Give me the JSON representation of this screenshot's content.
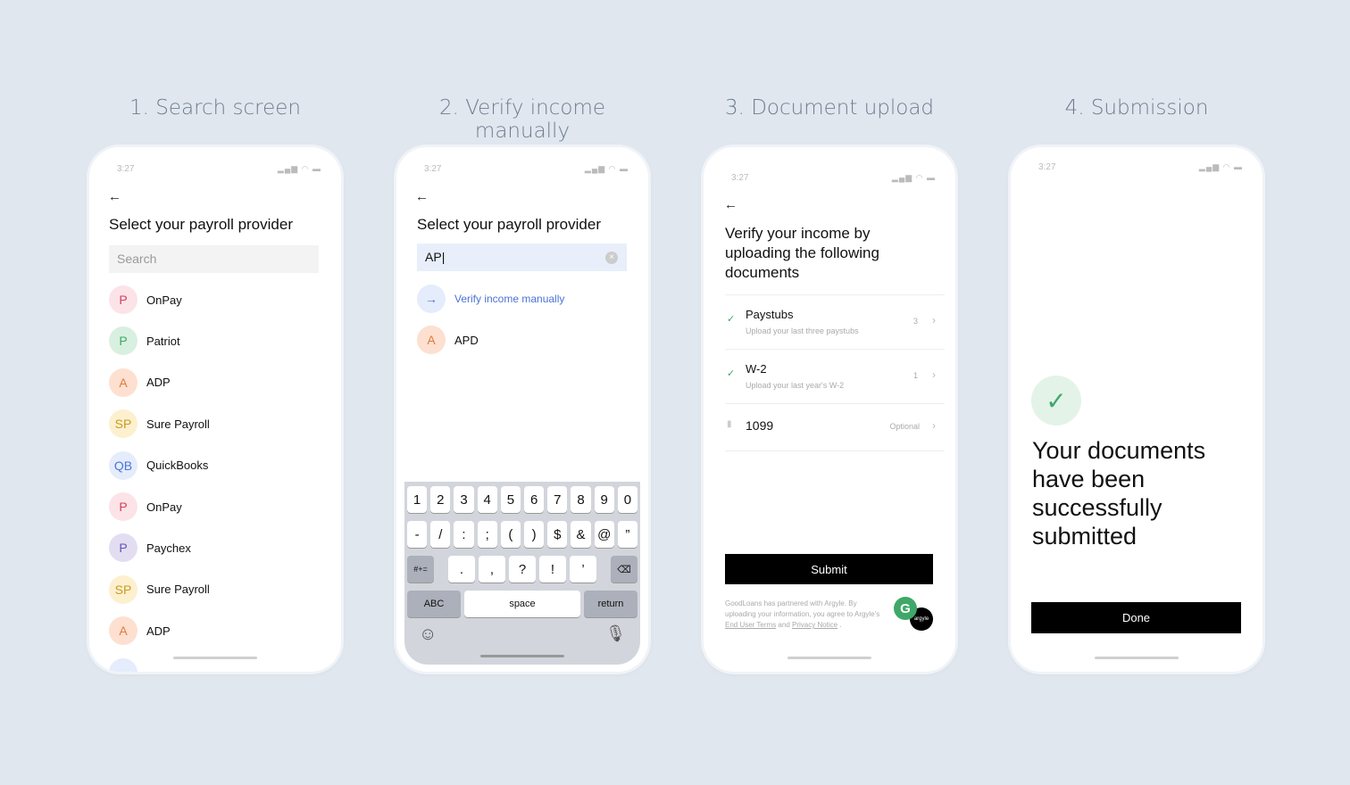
{
  "steps": [
    "1. Search screen",
    "2. Verify income manually",
    "3. Document upload",
    "4. Submission"
  ],
  "status": {
    "time": "3:27",
    "icons": "signal-wifi-battery"
  },
  "screen1": {
    "title": "Select your payroll provider",
    "search_placeholder": "Search",
    "providers": [
      {
        "initials": "P",
        "name": "OnPay",
        "bg": "#fbe3e7",
        "fg": "#d2405a"
      },
      {
        "initials": "P",
        "name": "Patriot",
        "bg": "#d8f0df",
        "fg": "#3fa869"
      },
      {
        "initials": "A",
        "name": "ADP",
        "bg": "#fde0d0",
        "fg": "#e07a3d"
      },
      {
        "initials": "SP",
        "name": "Sure Payroll",
        "bg": "#fdf0cf",
        "fg": "#c99a1e"
      },
      {
        "initials": "QB",
        "name": "QuickBooks",
        "bg": "#e5ecfb",
        "fg": "#4a74d6"
      },
      {
        "initials": "P",
        "name": "OnPay",
        "bg": "#fbe3e7",
        "fg": "#d2405a"
      },
      {
        "initials": "P",
        "name": "Paychex",
        "bg": "#e3ddf2",
        "fg": "#6a50b8"
      },
      {
        "initials": "SP",
        "name": "Sure Payroll",
        "bg": "#fdf0cf",
        "fg": "#c99a1e"
      },
      {
        "initials": "A",
        "name": "ADP",
        "bg": "#fde0d0",
        "fg": "#e07a3d"
      }
    ]
  },
  "screen2": {
    "title": "Select your payroll provider",
    "search_value": "AP",
    "verify_label": "Verify income manually",
    "result": {
      "initials": "A",
      "name": "APD"
    },
    "keyboard": {
      "row1": [
        "1",
        "2",
        "3",
        "4",
        "5",
        "6",
        "7",
        "8",
        "9",
        "0"
      ],
      "row2": [
        "-",
        "/",
        ":",
        ";",
        "(",
        ")",
        "$",
        "&",
        "@",
        "”"
      ],
      "row3": [
        ".",
        ",",
        "?",
        "!",
        "’"
      ],
      "symbols": "#+=",
      "abc": "ABC",
      "space": "space",
      "return": "return"
    }
  },
  "screen3": {
    "title": "Verify your income by uploading the following documents",
    "documents": [
      {
        "name": "Paystubs",
        "desc": "Upload your last three paystubs",
        "count": "3",
        "done": true
      },
      {
        "name": "W-2",
        "desc": "Upload your last year's W-2",
        "count": "1",
        "done": true
      },
      {
        "name": "1099",
        "desc": "",
        "count": "Optional",
        "done": false
      }
    ],
    "submit": "Submit",
    "footer": {
      "text": "GoodLoans has partnered with Argyle. By uploading your information, you agree to Argyle's ",
      "terms": "End User Terms",
      "and": " and ",
      "privacy": "Privacy Notice",
      "end": " .",
      "logo_g": "G",
      "logo_argyle": "argyle"
    }
  },
  "screen4": {
    "message": "Your documents have been successfully submitted",
    "done": "Done",
    "accent": "#3fa869"
  }
}
